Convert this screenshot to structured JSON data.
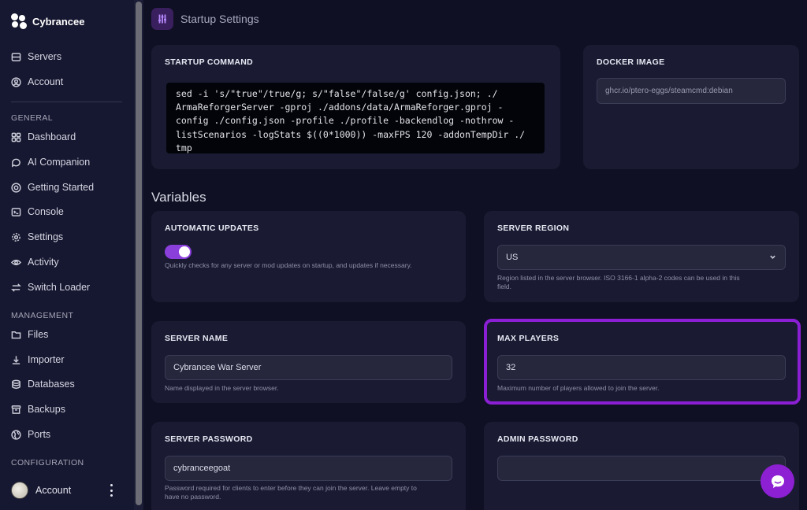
{
  "brand": {
    "name": "Cybrancee"
  },
  "sidebar": {
    "top_items": [
      {
        "label": "Servers",
        "icon": "server-icon"
      },
      {
        "label": "Account",
        "icon": "user-circle-icon"
      }
    ],
    "general_label": "GENERAL",
    "general_items": [
      {
        "label": "Dashboard",
        "icon": "grid-icon"
      },
      {
        "label": "AI Companion",
        "icon": "chat-icon"
      },
      {
        "label": "Getting Started",
        "icon": "lifebuoy-icon"
      },
      {
        "label": "Console",
        "icon": "terminal-icon"
      },
      {
        "label": "Settings",
        "icon": "gear-icon"
      },
      {
        "label": "Activity",
        "icon": "eye-icon"
      },
      {
        "label": "Switch Loader",
        "icon": "swap-icon"
      }
    ],
    "management_label": "MANAGEMENT",
    "management_items": [
      {
        "label": "Files",
        "icon": "folder-icon"
      },
      {
        "label": "Importer",
        "icon": "download-icon"
      },
      {
        "label": "Databases",
        "icon": "database-icon"
      },
      {
        "label": "Backups",
        "icon": "archive-icon"
      },
      {
        "label": "Ports",
        "icon": "globe-icon"
      }
    ],
    "configuration_label": "CONFIGURATION",
    "bottom_account_label": "Account"
  },
  "header": {
    "title": "Startup Settings"
  },
  "startup": {
    "command_title": "STARTUP COMMAND",
    "command_lines": [
      "sed -i 's/\"true\"/true/g; s/\"false\"/false/g' config.json; ./",
      "ArmaReforgerServer -gproj ./addons/data/ArmaReforger.gproj -",
      "config ./config.json -profile ./profile -backendlog -nothrow -",
      "listScenarios -logStats $((0*1000)) -maxFPS 120 -addonTempDir ./",
      "tmp"
    ],
    "docker_title": "DOCKER IMAGE",
    "docker_value": "ghcr.io/ptero-eggs/steamcmd:debian"
  },
  "variables": {
    "title": "Variables",
    "auto_updates": {
      "label": "AUTOMATIC UPDATES",
      "enabled": true,
      "help": "Quickly checks for any server or mod updates on startup, and updates if necessary."
    },
    "server_region": {
      "label": "SERVER REGION",
      "value": "US",
      "help_lines": [
        "Region listed in the server browser. ISO 3166-1 alpha-2 codes can be used in this",
        "field."
      ]
    },
    "server_name": {
      "label": "SERVER NAME",
      "value": "Cybrancee War Server",
      "help": "Name displayed in the server browser."
    },
    "max_players": {
      "label": "MAX PLAYERS",
      "value": "32",
      "help": "Maximum number of players allowed to join the server."
    },
    "server_password": {
      "label": "SERVER PASSWORD",
      "value": "cybranceegoat",
      "help_lines": [
        "Password required for clients to enter before they can join the server. Leave empty to",
        "have no password."
      ]
    },
    "admin_password": {
      "label": "ADMIN PASSWORD",
      "value": ""
    }
  },
  "colors": {
    "accent": "#8b1fd4",
    "toggle_on": "#8a3fdb",
    "background": "#0f1023",
    "card": "#1a1b33"
  }
}
